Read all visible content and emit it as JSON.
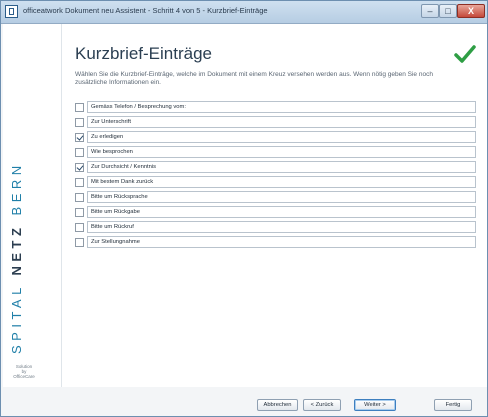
{
  "window": {
    "title": "officeatwork Dokument neu Assistent - Schritt 4 von 5 - Kurzbrief-Einträge",
    "controls": {
      "minimize": "–",
      "maximize": "□",
      "close": "X"
    }
  },
  "sidebar": {
    "brand_light_1": "SPITAL",
    "brand_bold": "NETZ",
    "brand_light_2": "BERN",
    "solution_line1": "Solution",
    "solution_line2": "by",
    "solution_line3": "OfficeCare",
    "powered_line1": "powered by",
    "powered_line2": "officeatwork"
  },
  "main": {
    "heading": "Kurzbrief-Einträge",
    "description": "Wählen Sie die Kurzbrief-Einträge, welche im Dokument mit einem Kreuz versehen werden aus. Wenn nötig geben Sie noch zusätzliche Informationen ein.",
    "items": [
      {
        "label": "Gemäss Telefon / Besprechung vom:",
        "checked": false
      },
      {
        "label": "Zur Unterschrift",
        "checked": false
      },
      {
        "label": "Zu erledigen",
        "checked": true
      },
      {
        "label": "Wie besprochen",
        "checked": false
      },
      {
        "label": "Zur Durchsicht / Kenntnis",
        "checked": true
      },
      {
        "label": "Mit bestem Dank zurück",
        "checked": false
      },
      {
        "label": "Bitte um Rücksprache",
        "checked": false
      },
      {
        "label": "Bitte um Rückgabe",
        "checked": false
      },
      {
        "label": "Bitte um Rückruf",
        "checked": false
      },
      {
        "label": "Zur Stellungnahme",
        "checked": false
      }
    ]
  },
  "footer": {
    "abort_label": "Abbrechen",
    "back_label": "< Zurück",
    "next_label": "Weiter >",
    "finish_label": "Fertig"
  },
  "colors": {
    "accent": "#1f7fa8",
    "check": "#2e9e44"
  }
}
